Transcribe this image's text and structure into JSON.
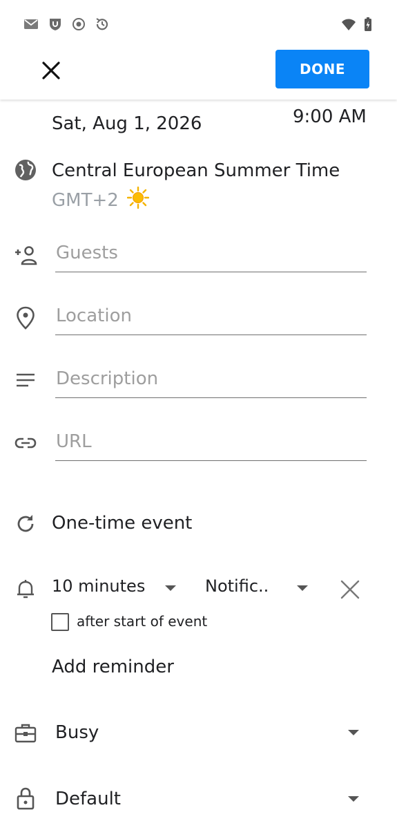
{
  "status_bar": {
    "left_icons": [
      "mail-icon",
      "shield-app-icon",
      "record-icon",
      "sync-icon"
    ],
    "right_icons": [
      "wifi-icon",
      "battery-charging-icon"
    ]
  },
  "app_bar": {
    "close_icon": "close-icon",
    "done_label": "DONE",
    "accent_color": "#0a84f6"
  },
  "event": {
    "date": "Sat, Aug 1, 2026",
    "time": "9:00 AM"
  },
  "timezone": {
    "name": "Central European Summer Time",
    "offset": "GMT+2",
    "emoji": "☀️"
  },
  "fields": {
    "guests_placeholder": "Guests",
    "location_placeholder": "Location",
    "description_placeholder": "Description",
    "url_placeholder": "URL"
  },
  "recurrence": {
    "label": "One-time event"
  },
  "reminder": {
    "duration": "10 minutes",
    "method": "Notific..",
    "after_start_label": "after start of event",
    "after_start_checked": false,
    "add_label": "Add reminder"
  },
  "availability": {
    "value": "Busy"
  },
  "visibility": {
    "value": "Default"
  }
}
